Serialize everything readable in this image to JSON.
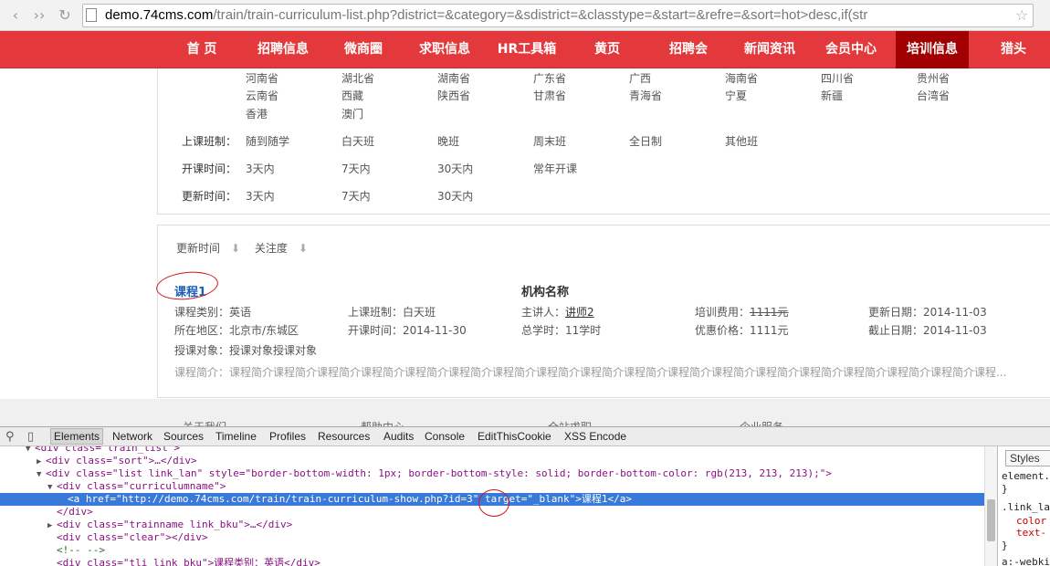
{
  "browser": {
    "url_host": "demo.74cms.com",
    "url_rest": "/train/train-curriculum-list.php?district=&category=&sdistrict=&classtype=&start=&refre=&sort=hot>desc,if(str"
  },
  "nav": {
    "items": [
      "首 页",
      "招聘信息",
      "微商圈",
      "求职信息",
      "HR工具箱",
      "黄页",
      "招聘会",
      "新闻资讯",
      "会员中心",
      "培训信息",
      "猎头"
    ],
    "active_index": 9
  },
  "filters": {
    "regions_row1": [
      "河南省",
      "湖北省",
      "湖南省",
      "广东省",
      "广西",
      "海南省",
      "四川省",
      "贵州省"
    ],
    "regions_row2": [
      "云南省",
      "西藏",
      "陕西省",
      "甘肃省",
      "青海省",
      "宁夏",
      "新疆",
      "台湾省"
    ],
    "regions_row3": [
      "香港",
      "澳门"
    ],
    "class_type": {
      "label": "上课班制：",
      "options": [
        "随到随学",
        "白天班",
        "晚班",
        "周末班",
        "全日制",
        "其他班"
      ]
    },
    "start_time": {
      "label": "开课时间：",
      "options": [
        "3天内",
        "7天内",
        "30天内",
        "常年开课"
      ]
    },
    "update_time": {
      "label": "更新时间：",
      "options": [
        "3天内",
        "7天内",
        "30天内"
      ]
    }
  },
  "sort": {
    "by_update": "更新时间",
    "by_attention": "关注度",
    "arrow": "⬇"
  },
  "course": {
    "title": "课程1",
    "org": "机构名称",
    "category": "课程类别：英语",
    "class_type": "上课班制：白天班",
    "lecturer_label": "主讲人：",
    "lecturer": "讲师2",
    "fee_label": "培训费用：",
    "fee": "1111元",
    "update_date": "更新日期：2014-11-03",
    "district": "所在地区：北京市/东城区",
    "start_time": "开课时间：2014-11-30",
    "hours": "总学时：11学时",
    "discount": "优惠价格：1111元",
    "deadline": "截止日期：2014-11-03",
    "audience": "授课对象：授课对象授课对象",
    "intro": "课程简介：课程简介课程简介课程简介课程简介课程简介课程简介课程简介课程简介课程简介课程简介课程简介课程简介课程简介课程简介课程简介课程简介课程简介课程..."
  },
  "footer": {
    "links": [
      "关于我们",
      "帮助中心",
      "全站求职",
      "企业服务"
    ]
  },
  "devtools": {
    "tabs": [
      "Elements",
      "Network",
      "Sources",
      "Timeline",
      "Profiles",
      "Resources",
      "Audits",
      "Console",
      "EditThisCookie",
      "XSS Encode"
    ],
    "dom_lines": [
      {
        "t": "▼",
        "html": "<div class=\"train_list\">"
      },
      {
        "t": "▶",
        "html": "<div class=\"sort\">…</div>"
      },
      {
        "t": "▼",
        "html": "<div class=\"list link_lan\" style=\"border-bottom-width: 1px; border-bottom-style: solid; border-bottom-color: rgb(213, 213, 213);\">"
      },
      {
        "t": "▼",
        "html": "<div class=\"curriculumname\">"
      },
      {
        "t": "",
        "html": "<a href=\"http://demo.74cms.com/train/train-curriculum-show.php?id=3\" target=\"_blank\">课程1</a>"
      },
      {
        "t": "",
        "html": "</div>"
      },
      {
        "t": "▶",
        "html": "<div class=\"trainname link_bku\">…</div>"
      },
      {
        "t": "",
        "html": "<div class=\"clear\"></div>"
      },
      {
        "t": "",
        "html": "<!-- -->"
      },
      {
        "t": "",
        "html": "<div class=\"tli link_bku\">课程类别：英语</div>"
      }
    ],
    "styles": {
      "tab": "Styles",
      "lines": [
        "element.",
        "}",
        ".link_la",
        "color",
        "text-",
        "}",
        "a:-webki"
      ]
    }
  }
}
